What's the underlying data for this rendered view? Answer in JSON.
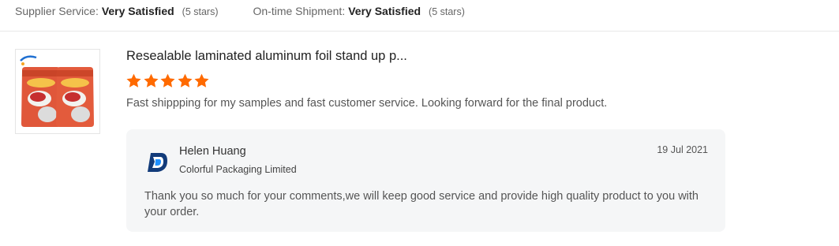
{
  "summary": {
    "supplier_service": {
      "label": "Supplier Service:",
      "value": "Very Satisfied",
      "note": "(5 stars)"
    },
    "ontime_shipment": {
      "label": "On-time Shipment:",
      "value": "Very Satisfied",
      "note": "(5 stars)"
    }
  },
  "review": {
    "product_title": "Resealable laminated aluminum foil stand up p...",
    "rating": 5,
    "rating_max": 5,
    "star_color": "#ff6a00",
    "text": "Fast shippping for my samples and fast customer service. Looking forward for the final product."
  },
  "reply": {
    "seller_name": "Helen Huang",
    "company": "Colorful Packaging Limited",
    "date": "19 Jul 2021",
    "message": "Thank you so much for your comments,we will keep good service and provide high quality product to you with your order.",
    "logo_icon": "company-logo-icon"
  }
}
